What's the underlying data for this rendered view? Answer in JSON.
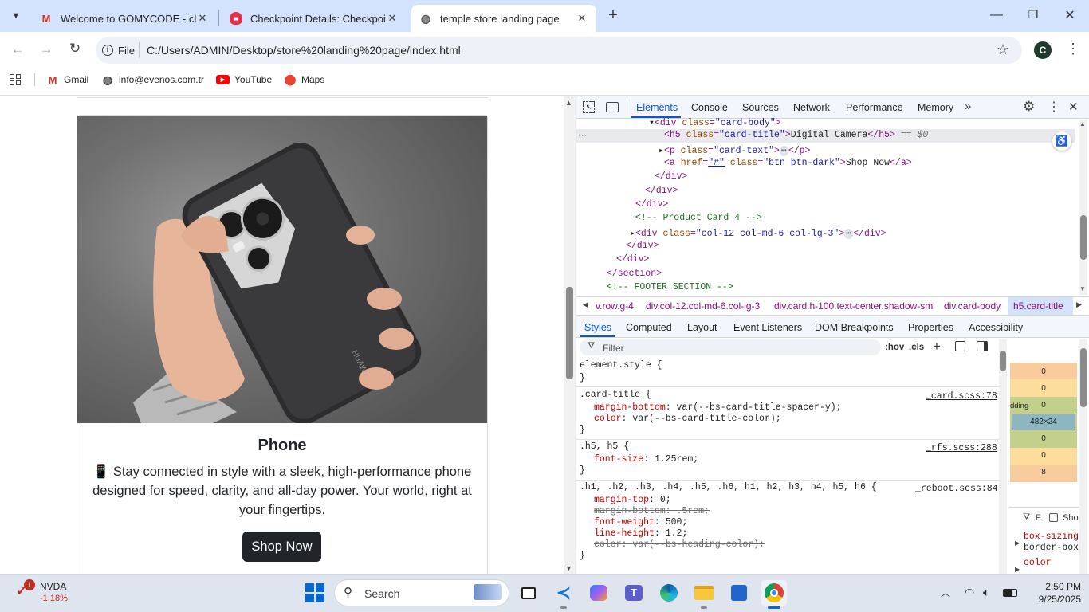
{
  "browser": {
    "tabs": [
      {
        "title": "Welcome to GOMYCODE - chijio",
        "favicon": "gmail-icon"
      },
      {
        "title": "Checkpoint Details: Checkpoint",
        "favicon": "gomycode-icon"
      },
      {
        "title": "temple store landing page",
        "favicon": "globe-icon"
      }
    ],
    "address": {
      "scheme_label": "File",
      "url": "C:/Users/ADMIN/Desktop/store%20landing%20page/index.html"
    },
    "profile_initial": "C",
    "bookmarks": [
      "Gmail",
      "info@evenos.com.tr",
      "YouTube",
      "Maps"
    ]
  },
  "page": {
    "card": {
      "title": "Phone",
      "text": "📱 Stay connected in style with a sleek, high-performance phone designed for speed, clarity, and all-day power. Your world, right at your fingertips.",
      "button": "Shop Now",
      "phone_brand": "HUAWEI"
    }
  },
  "devtools": {
    "tabs": [
      "Elements",
      "Console",
      "Sources",
      "Network",
      "Performance",
      "Memory"
    ],
    "active_tab": "Elements",
    "dom_lines": [
      {
        "l1": "<div ",
        "a": "class",
        "v": "\"card-body\"",
        "end": ">"
      },
      {
        "l1": "<h5 ",
        "a": "class",
        "v": "\"card-title\"",
        "end": ">",
        "text": "Digital Camera",
        "close": "</h5>",
        "eq": " == $0"
      },
      {
        "l1": "<p ",
        "a": "class",
        "v": "\"card-text\"",
        "end": ">",
        "close": "</p>"
      },
      {
        "l1": "<a ",
        "a": "href",
        "v": "\"#\"",
        "a2": "class",
        "v2": "\"btn btn-dark\"",
        "end": ">",
        "text": "Shop Now",
        "close": "</a>"
      },
      {
        "l1": "</div>"
      },
      {
        "l1": "</div>"
      },
      {
        "l1": "</div>"
      },
      {
        "comment": "<!-- Product Card 4 -->"
      },
      {
        "l1": "<div ",
        "a": "class",
        "v": "\"col-12 col-md-6 col-lg-3\"",
        "end": ">",
        "close": "</div>"
      },
      {
        "l1": "</div>"
      },
      {
        "l1": "</div>"
      },
      {
        "l1": "</section>"
      },
      {
        "comment": "<!-- FOOTER SECTION -->"
      }
    ],
    "breadcrumbs": [
      "v.row.g-4",
      "div.col-12.col-md-6.col-lg-3",
      "div.card.h-100.text-center.shadow-sm",
      "div.card-body",
      "h5.card-title"
    ],
    "subtabs": [
      "Styles",
      "Computed",
      "Layout",
      "Event Listeners",
      "DOM Breakpoints",
      "Properties",
      "Accessibility"
    ],
    "filter_placeholder": "Filter",
    "filter_hov": ":hov",
    "filter_cls": ".cls",
    "styles": {
      "element_style": "element.style {",
      "rule1_sel": ".card-title {",
      "rule1_src": "_card.scss:78",
      "rule1_p1": "margin-bottom",
      "rule1_v1": "var(--bs-card-title-spacer-y);",
      "rule1_p2": "color",
      "rule1_v2": "var(--bs-card-title-color);",
      "rule2_sel": ".h5, h5 {",
      "rule2_src": "_rfs.scss:288",
      "rule2_p1": "font-size",
      "rule2_v1": "1.25rem;",
      "rule3_sel": ".h1, .h2, .h3, .h4, .h5, .h6, h1, h2, h3, h4, h5, h6 {",
      "rule3_src": "_reboot.scss:84",
      "rule3_p1": "margin-top",
      "rule3_v1": "0;",
      "rule3_p2": "margin-bottom",
      "rule3_v2": ".5rem;",
      "rule3_p3": "font-weight",
      "rule3_v3": "500;",
      "rule3_p4": "line-height",
      "rule3_v4": "1.2;",
      "rule3_p5": "color",
      "rule3_v5": "var(--bs-heading-color);",
      "brace": "}"
    },
    "boxmodel": {
      "margin_top": "0",
      "border_top": "0",
      "padding_label": "dding",
      "padding_top": "0",
      "content": "482×24",
      "padding_bottom": "0",
      "border_bottom": "0",
      "margin_bottom": "8"
    },
    "computed": {
      "filter": "F",
      "show_label": "Sho",
      "p1": "box-sizing",
      "v1": "border-box",
      "p2": "color"
    }
  },
  "taskbar": {
    "stock_name": "NVDA",
    "stock_change": "-1.18%",
    "stock_badge": "1",
    "search_label": "Search",
    "time": "2:50 PM",
    "date": "9/25/2025"
  },
  "colors": {
    "tabstrip": "#d3e3fd",
    "accent": "#0b57d0",
    "button": "#212529"
  }
}
